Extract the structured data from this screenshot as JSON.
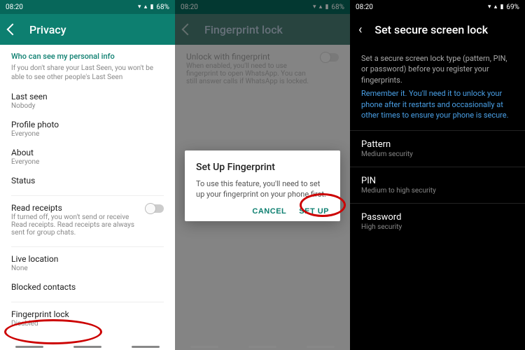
{
  "status": {
    "time": "08:20",
    "battery": "68%",
    "battery3": "69%",
    "icons": "▾ ▴ ▮"
  },
  "s1": {
    "header": "Privacy",
    "section_link": "Who can see my personal info",
    "note": "If you don't share your Last Seen, you won't be able to see other people's Last Seen",
    "last_seen": {
      "title": "Last seen",
      "sub": "Nobody"
    },
    "profile_photo": {
      "title": "Profile photo",
      "sub": "Everyone"
    },
    "about": {
      "title": "About",
      "sub": "Everyone"
    },
    "status": {
      "title": "Status"
    },
    "read_receipts": {
      "title": "Read receipts",
      "sub": "If turned off, you won't send or receive Read receipts. Read receipts are always sent for group chats."
    },
    "live_location": {
      "title": "Live location",
      "sub": "None"
    },
    "blocked": {
      "title": "Blocked contacts"
    },
    "fingerprint": {
      "title": "Fingerprint lock",
      "sub": "Disabled"
    }
  },
  "s2": {
    "header": "Fingerprint lock",
    "unlock": {
      "title": "Unlock with fingerprint",
      "sub": "When enabled, you'll need to use fingerprint to open WhatsApp. You can still answer calls if WhatsApp is locked."
    },
    "dialog": {
      "title": "Set Up Fingerprint",
      "body": "To use this feature, you'll need to set up your fingerprint on your phone first.",
      "cancel": "CANCEL",
      "setup": "SET UP"
    }
  },
  "s3": {
    "header": "Set secure screen lock",
    "desc": "Set a secure screen lock type (pattern, PIN, or password) before you register your fingerprints.",
    "warn": "Remember it. You'll need it to unlock your phone after it restarts and occasionally at other times to ensure your phone is secure.",
    "pattern": {
      "title": "Pattern",
      "sub": "Medium security"
    },
    "pin": {
      "title": "PIN",
      "sub": "Medium to high security"
    },
    "password": {
      "title": "Password",
      "sub": "High security"
    }
  }
}
